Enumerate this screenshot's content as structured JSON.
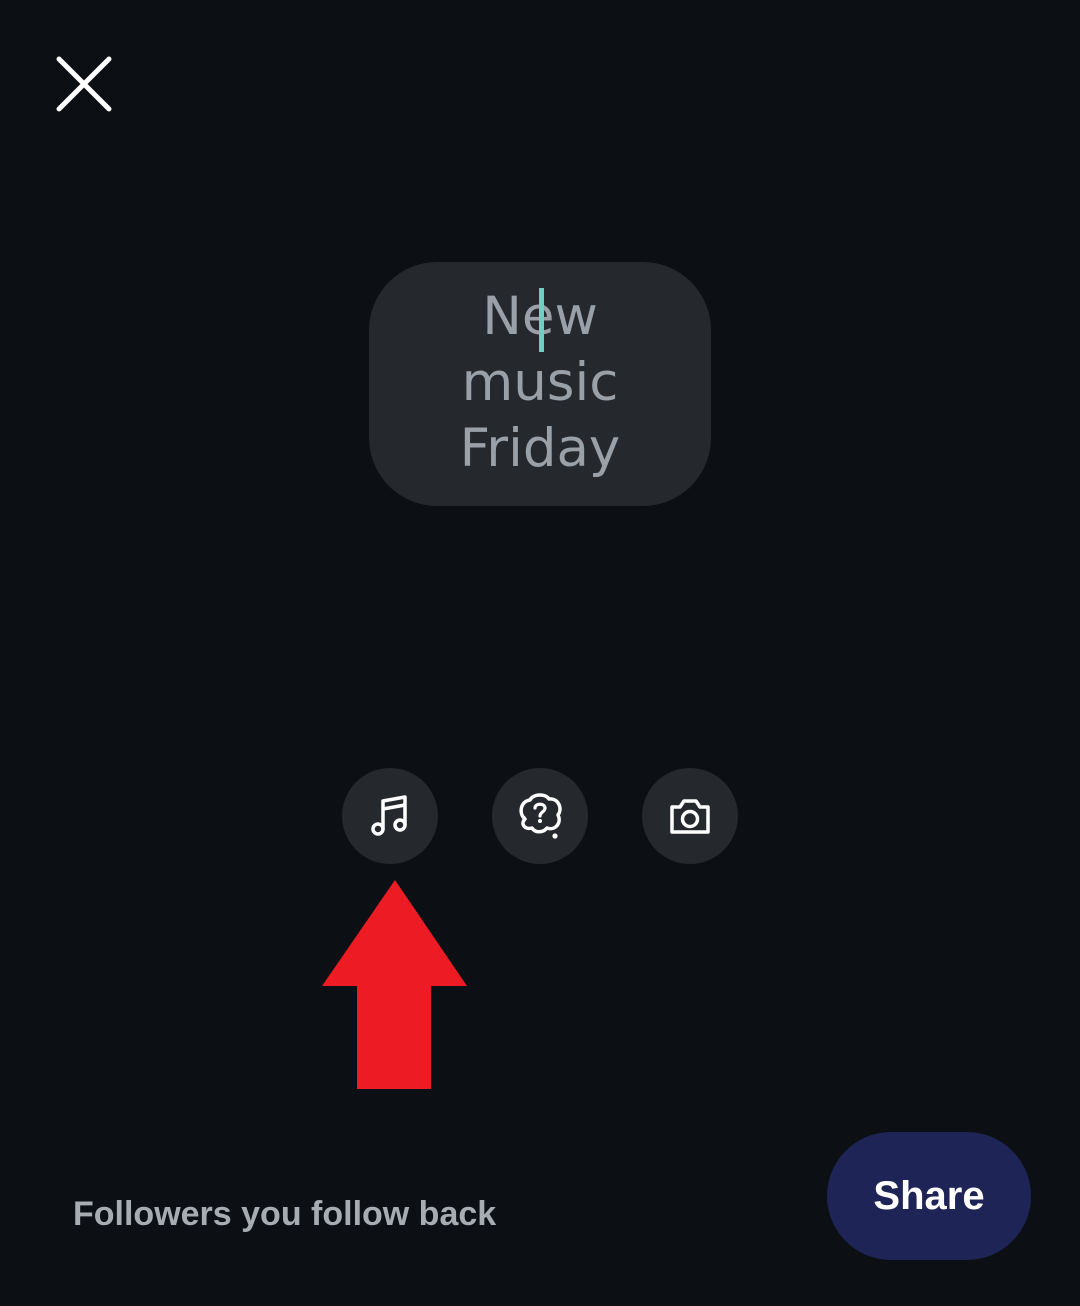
{
  "header": {
    "close_icon": "close-icon"
  },
  "note": {
    "text": "New\nmusic\nFriday",
    "bubble_color": "#25282d",
    "text_color": "#9aa0a8",
    "caret_color": "#6dd0c0"
  },
  "tools": [
    {
      "icon": "music-note-icon"
    },
    {
      "icon": "question-bubble-icon"
    },
    {
      "icon": "camera-icon"
    }
  ],
  "annotation": {
    "icon": "red-arrow-up-icon",
    "color": "#ed1c24"
  },
  "footer": {
    "audience_label": "Followers you follow back",
    "share_label": "Share",
    "share_color": "#1f2457"
  },
  "colors": {
    "background": "#0c0f14"
  }
}
